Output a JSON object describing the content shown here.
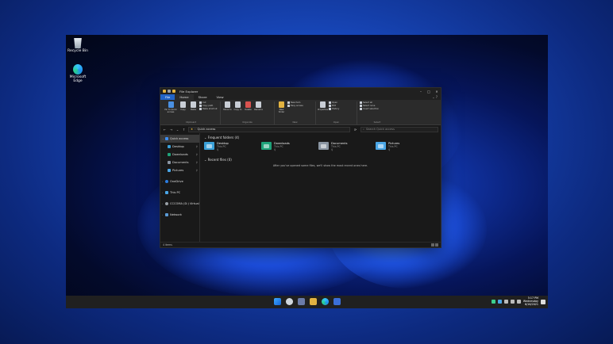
{
  "desktop": {
    "icons": [
      {
        "label": "Recycle Bin"
      },
      {
        "label": "Microsoft Edge"
      }
    ]
  },
  "window": {
    "title": "File Explorer",
    "tabs": [
      "File",
      "Home",
      "Share",
      "View"
    ],
    "ribbon": {
      "clipboard": {
        "label": "Clipboard",
        "pin": "Pin to Quick access",
        "copy": "Copy",
        "paste": "Paste",
        "cut": "Cut",
        "copy_path": "Copy path",
        "paste_shortcut": "Paste shortcut"
      },
      "organize": {
        "label": "Organize",
        "move_to": "Move to",
        "copy_to": "Copy to",
        "delete": "Delete",
        "rename": "Rename"
      },
      "new": {
        "label": "New",
        "new_folder": "New folder",
        "new_item": "New item",
        "easy_access": "Easy access"
      },
      "open": {
        "label": "Open",
        "properties": "Properties",
        "open": "Open",
        "edit": "Edit",
        "history": "History"
      },
      "select": {
        "label": "Select",
        "select_all": "Select all",
        "select_none": "Select none",
        "invert": "Invert selection"
      }
    },
    "address": {
      "path": "Quick access",
      "search_placeholder": "Search Quick access"
    },
    "nav_pane": {
      "items": [
        {
          "label": "Quick access"
        },
        {
          "label": "Desktop"
        },
        {
          "label": "Downloads"
        },
        {
          "label": "Documents"
        },
        {
          "label": "Pictures"
        },
        {
          "label": "OneDrive"
        },
        {
          "label": "This PC"
        },
        {
          "label": "CCCOMA (D:) Virtual"
        },
        {
          "label": "Network"
        }
      ]
    },
    "content": {
      "frequent_title": "Frequent folders (4)",
      "folders": [
        {
          "name": "Desktop",
          "location": "This PC"
        },
        {
          "name": "Downloads",
          "location": "This PC"
        },
        {
          "name": "Documents",
          "location": "This PC"
        },
        {
          "name": "Pictures",
          "location": "This PC"
        }
      ],
      "recent_title": "Recent files (0)",
      "recent_empty": "After you've opened some files, we'll show the most recent ones here."
    },
    "status": {
      "items": "4 items"
    }
  },
  "taskbar": {
    "time": "5:17 PM",
    "day": "Wednesday",
    "date": "6/16/2021"
  },
  "colors": {
    "accent": "#2264c8",
    "folder_desktop": "#3aa0d8",
    "folder_downloads": "#1fa37a",
    "folder_documents": "#8b96a3",
    "folder_pictures": "#4aa6e6"
  }
}
